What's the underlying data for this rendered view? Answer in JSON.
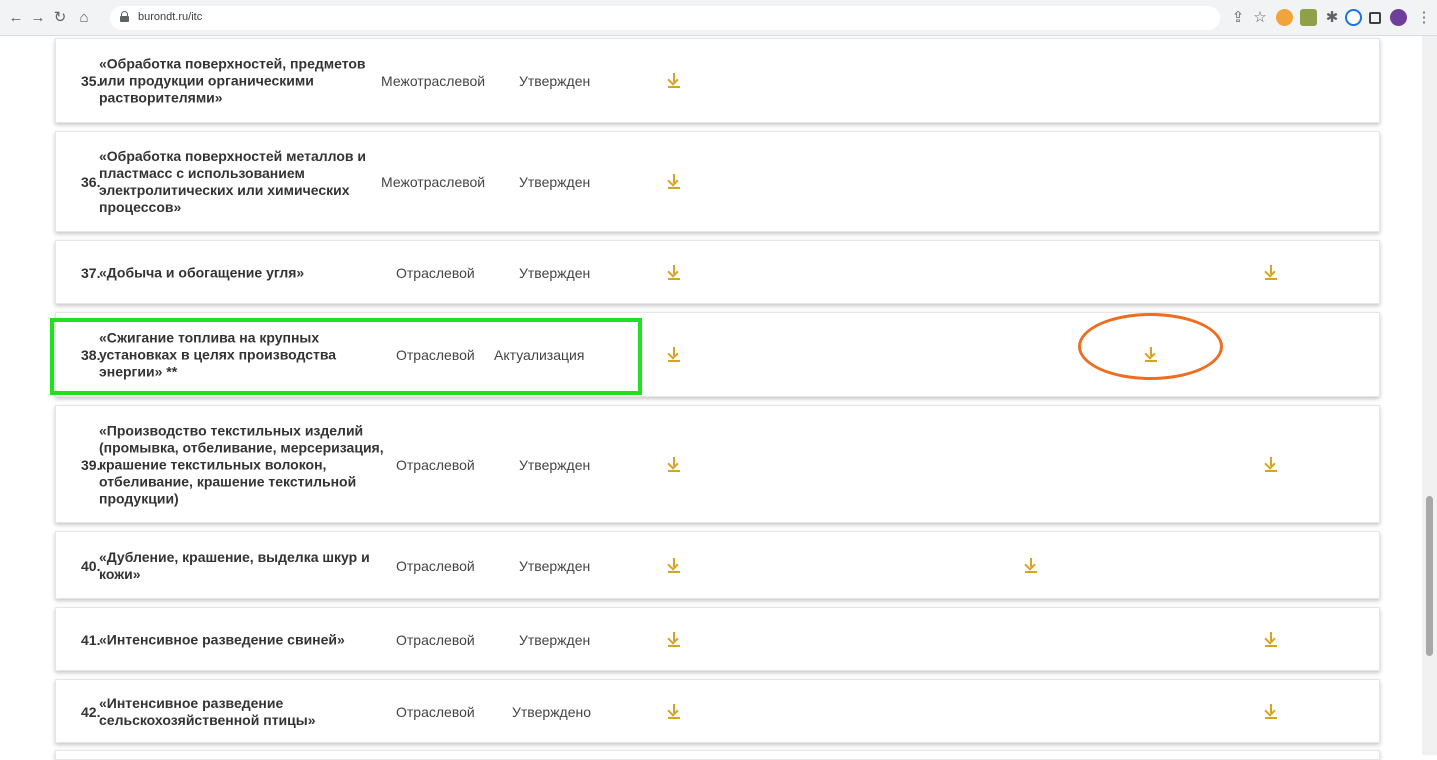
{
  "browser": {
    "url": "burondt.ru/itc",
    "colors": {
      "toolbar": "#f1f3f4",
      "download_icon": "#d6a323",
      "highlight_box": "#1ee21e",
      "highlight_ellipse": "#ee6d1e"
    }
  },
  "rows": [
    {
      "num": "35.",
      "name": "«Обработка поверхностей, предметов или продукции органическими растворителями»",
      "type": "Межотраслевой",
      "status": "Утвержден"
    },
    {
      "num": "36.",
      "name": "«Обработка поверхностей металлов и пластмасс с использованием электролитических или химических процессов»",
      "type": "Межотраслевой",
      "status": "Утвержден"
    },
    {
      "num": "37.",
      "name": "«Добыча и обогащение угля»",
      "type": "Отраслевой",
      "status": "Утвержден"
    },
    {
      "num": "38.",
      "name": "«Сжигание топлива на крупных установках в целях производства энергии» **",
      "type": "Отраслевой",
      "status": "Актуализация"
    },
    {
      "num": "39.",
      "name": "«Производство текстильных изделий (промывка, отбеливание, мерсеризация, крашение текстильных волокон, отбеливание, крашение текстильной продукции)",
      "type": "Отраслевой",
      "status": "Утвержден"
    },
    {
      "num": "40.",
      "name": "«Дубление, крашение, выделка шкур и кожи»",
      "type": "Отраслевой",
      "status": "Утвержден"
    },
    {
      "num": "41.",
      "name": "«Интенсивное разведение свиней»",
      "type": "Отраслевой",
      "status": "Утвержден"
    },
    {
      "num": "42.",
      "name": "«Интенсивное разведение сельскохозяйственной птицы»",
      "type": "Отраслевой",
      "status": "Утверждено"
    }
  ]
}
